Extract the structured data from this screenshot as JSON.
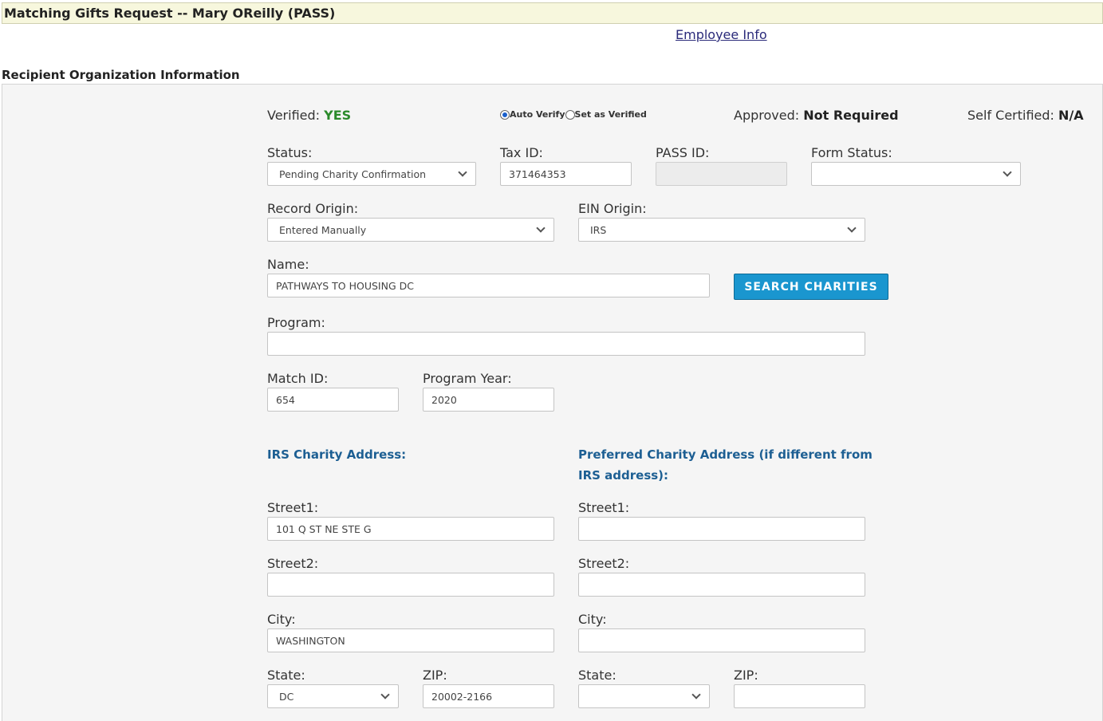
{
  "header": {
    "title": "Matching Gifts Request -- Mary OReilly (PASS)",
    "employee_link": "Employee Info"
  },
  "section_title": "Recipient Organization Information",
  "verification": {
    "verified_label": "Verified:",
    "verified_value": "YES",
    "radio_auto": "Auto Verify",
    "radio_set": "Set as Verified",
    "approved_label": "Approved:",
    "approved_value": "Not Required",
    "self_cert_label": "Self Certified:",
    "self_cert_value": "N/A"
  },
  "fields": {
    "status": {
      "label": "Status:",
      "value": "Pending Charity Confirmation"
    },
    "tax_id": {
      "label": "Tax ID:",
      "value": "371464353"
    },
    "pass_id": {
      "label": "PASS ID:",
      "value": ""
    },
    "form_status": {
      "label": "Form Status:",
      "value": ""
    },
    "record_origin": {
      "label": "Record Origin:",
      "value": "Entered Manually"
    },
    "ein_origin": {
      "label": "EIN Origin:",
      "value": "IRS"
    },
    "name": {
      "label": "Name:",
      "value": "PATHWAYS TO HOUSING DC"
    },
    "search_button": "SEARCH CHARITIES",
    "program": {
      "label": "Program:",
      "value": ""
    },
    "match_id": {
      "label": "Match ID:",
      "value": "654"
    },
    "program_year": {
      "label": "Program Year:",
      "value": "2020"
    }
  },
  "irs_address": {
    "heading": "IRS Charity Address:",
    "street1": {
      "label": "Street1:",
      "value": "101 Q ST NE STE G"
    },
    "street2": {
      "label": "Street2:",
      "value": ""
    },
    "city": {
      "label": "City:",
      "value": "WASHINGTON"
    },
    "state": {
      "label": "State:",
      "value": "DC"
    },
    "zip": {
      "label": "ZIP:",
      "value": "20002-2166"
    }
  },
  "preferred_address": {
    "heading_line1": "Preferred Charity Address (if different from",
    "heading_line2": "IRS address):",
    "street1": {
      "label": "Street1:",
      "value": ""
    },
    "street2": {
      "label": "Street2:",
      "value": ""
    },
    "city": {
      "label": "City:",
      "value": ""
    },
    "state": {
      "label": "State:",
      "value": ""
    },
    "zip": {
      "label": "ZIP:",
      "value": ""
    }
  }
}
